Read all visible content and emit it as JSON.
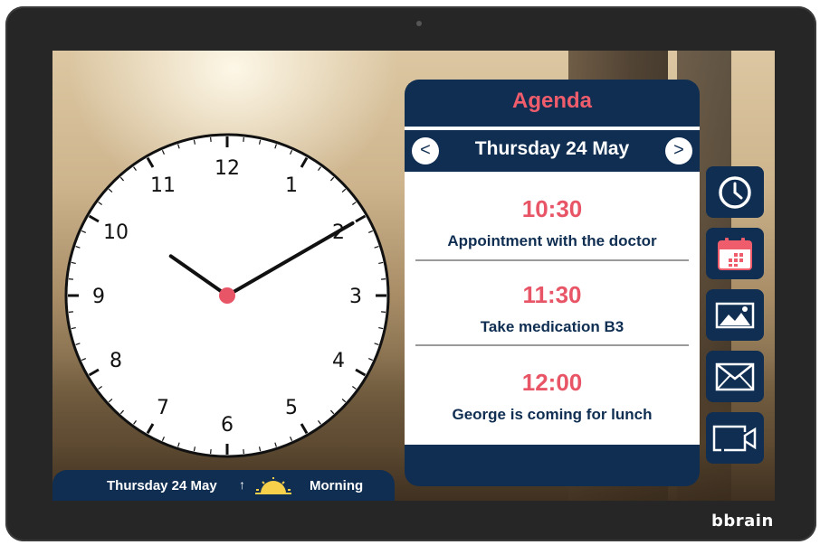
{
  "brand": "bbrain",
  "clock": {
    "numbers": [
      "12",
      "1",
      "2",
      "3",
      "4",
      "5",
      "6",
      "7",
      "8",
      "9",
      "10",
      "11"
    ],
    "time": "10:10"
  },
  "status_bar": {
    "date": "Thursday 24 May",
    "arrow": "↑",
    "weather_icon": "sun-rising-icon",
    "period": "Morning"
  },
  "agenda": {
    "title": "Agenda",
    "prev_label": "<",
    "next_label": ">",
    "date": "Thursday 24 May",
    "events": [
      {
        "time": "10:30",
        "text": "Appointment with the doctor"
      },
      {
        "time": "11:30",
        "text": "Take medication B3"
      },
      {
        "time": "12:00",
        "text": "George is coming for lunch"
      }
    ]
  },
  "sidebar": {
    "items": [
      {
        "icon": "clock-icon"
      },
      {
        "icon": "calendar-icon"
      },
      {
        "icon": "photos-icon"
      },
      {
        "icon": "mail-icon"
      },
      {
        "icon": "video-call-icon"
      }
    ]
  },
  "colors": {
    "navy": "#0f2e52",
    "accent_red": "#ef5d6c",
    "clock_center": "#e85566"
  }
}
